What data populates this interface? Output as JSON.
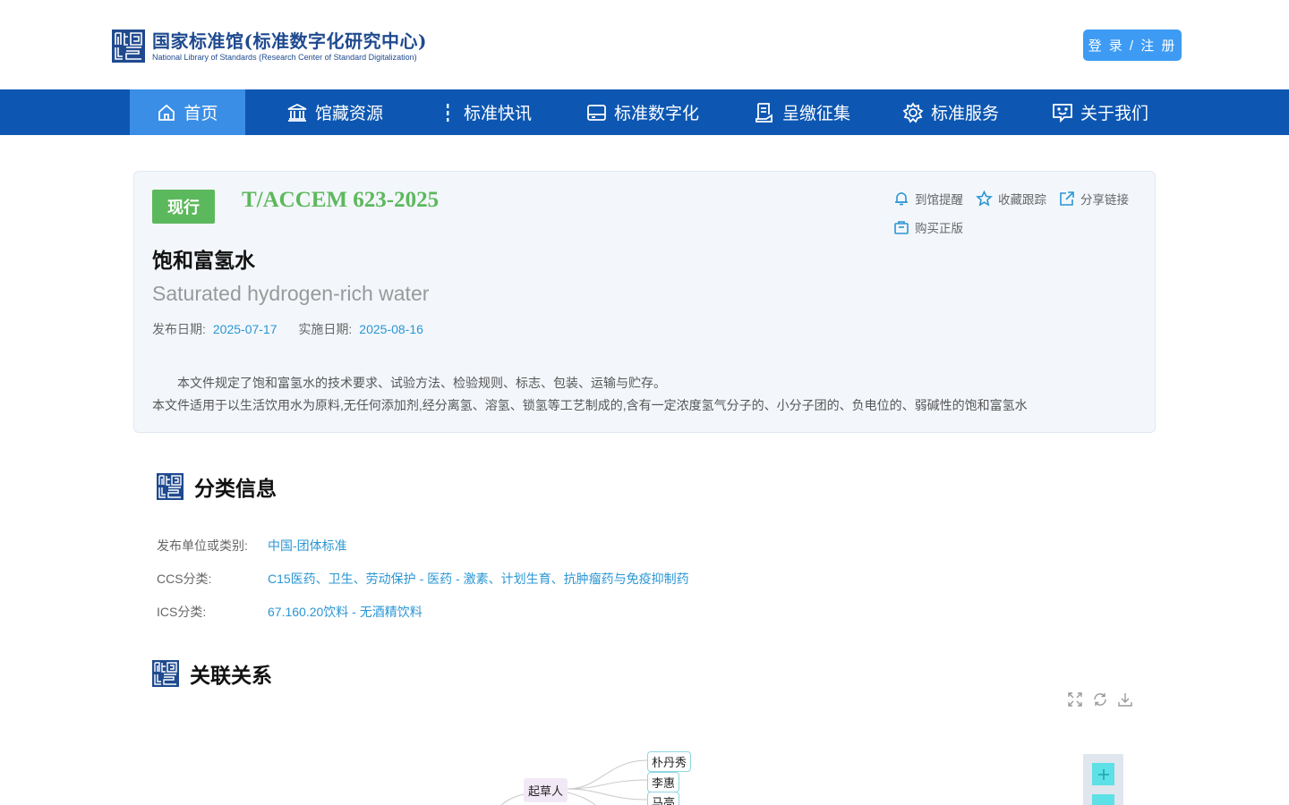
{
  "header": {
    "logo_cn": "国家标准馆(标准数字化研究中心)",
    "logo_en": "National Library of Standards (Research Center of Standard Digitalization)",
    "login_label": "登 录 / 注 册"
  },
  "nav": {
    "items": [
      {
        "label": "首页",
        "icon": "home-icon"
      },
      {
        "label": "馆藏资源",
        "icon": "library-icon"
      },
      {
        "label": "标准快讯",
        "icon": "news-icon"
      },
      {
        "label": "标准数字化",
        "icon": "digital-icon"
      },
      {
        "label": "呈缴征集",
        "icon": "submit-icon"
      },
      {
        "label": "标准服务",
        "icon": "service-icon"
      },
      {
        "label": "关于我们",
        "icon": "about-icon"
      }
    ],
    "active_index": 0
  },
  "standard": {
    "status": "现行",
    "code": "T/ACCEM 623-2025",
    "title_cn": "饱和富氢水",
    "title_en": "Saturated hydrogen-rich water",
    "publish_label": "发布日期:",
    "publish_date": "2025-07-17",
    "implement_label": "实施日期:",
    "implement_date": "2025-08-16",
    "desc_line1": "本文件规定了饱和富氢水的技术要求、试验方法、检验规则、标志、包装、运输与贮存。",
    "desc_line2": "本文件适用于以生活饮用水为原料,无任何添加剂,经分离氢、溶氢、锁氢等工艺制成的,含有一定浓度氢气分子的、小分子团的、负电位的、弱碱性的饱和富氢水",
    "actions": {
      "remind": "到馆提醒",
      "favorite": "收藏跟踪",
      "share": "分享链接",
      "buy": "购买正版"
    }
  },
  "classification": {
    "title": "分类信息",
    "rows": [
      {
        "key": "发布单位或类别:",
        "value": "中国-团体标准"
      },
      {
        "key": "CCS分类:",
        "value": "C15医药、卫生、劳动保护 - 医药 - 激素、计划生育、抗肿瘤药与免疫抑制药"
      },
      {
        "key": "ICS分类:",
        "value": "67.160.20饮料 - 无酒精饮料"
      }
    ]
  },
  "relations": {
    "title": "关联关系",
    "root": "起草人",
    "leaves": [
      "朴丹秀",
      "李惠",
      "马亮"
    ]
  },
  "colors": {
    "nav_bg": "#0d57b2",
    "nav_active": "#3a8ee6",
    "status_green": "#5cb85c",
    "link_blue": "#2a96d4",
    "login_blue": "#3d9bf4"
  }
}
